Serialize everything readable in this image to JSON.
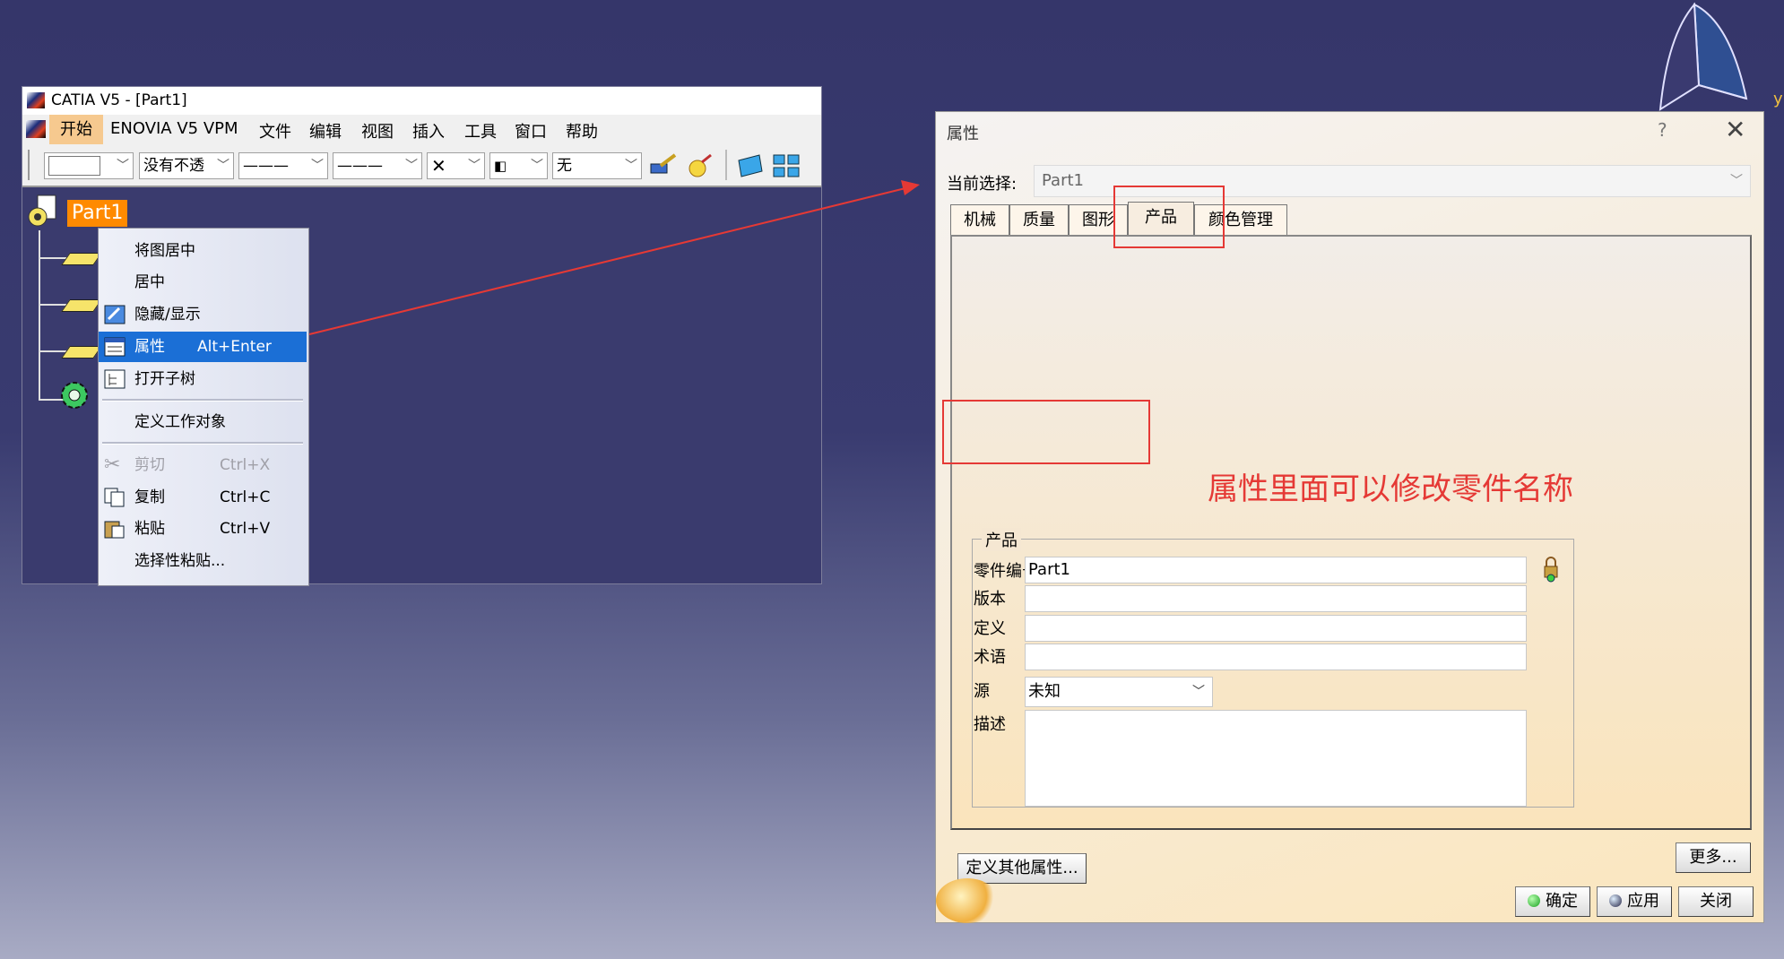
{
  "catia": {
    "title": "CATIA V5 - [Part1]",
    "menus": [
      "开始",
      "ENOVIA V5 VPM",
      "文件",
      "编辑",
      "视图",
      "插入",
      "工具",
      "窗口",
      "帮助"
    ],
    "toolbar": {
      "color_value": "",
      "transparency_value": "没有不透",
      "line_type_value": "———",
      "line_weight_value": "———",
      "layer_value": "无"
    },
    "tree": {
      "root_label": "Part1"
    },
    "context_menu": {
      "items": [
        {
          "label": "将图居中",
          "shortcut": ""
        },
        {
          "label": "居中",
          "shortcut": ""
        },
        {
          "label": "隐藏/显示",
          "shortcut": ""
        },
        {
          "label": "属性",
          "shortcut": "Alt+Enter"
        },
        {
          "label": "打开子树",
          "shortcut": ""
        },
        {
          "label": "定义工作对象",
          "shortcut": ""
        },
        {
          "label": "剪切",
          "shortcut": "Ctrl+X"
        },
        {
          "label": "复制",
          "shortcut": "Ctrl+C"
        },
        {
          "label": "粘贴",
          "shortcut": "Ctrl+V"
        },
        {
          "label": "选择性粘贴...",
          "shortcut": ""
        }
      ]
    }
  },
  "dialog": {
    "title": "属性",
    "help": "?",
    "close": "✕",
    "current_selection_label": "当前选择:",
    "current_selection_value": "Part1",
    "tabs": [
      "机械",
      "质量",
      "图形",
      "产品",
      "颜色管理"
    ],
    "active_tab": "产品",
    "annotation": "属性里面可以修改零件名称",
    "group_title": "产品",
    "fields": {
      "part_number_label": "零件编号",
      "part_number_value": "Part1",
      "revision_label": "版本",
      "revision_value": "",
      "definition_label": "定义",
      "definition_value": "",
      "nomenclature_label": "术语",
      "nomenclature_value": "",
      "source_label": "源",
      "source_value": "未知",
      "description_label": "描述",
      "description_value": ""
    },
    "buttons": {
      "define_other": "定义其他属性...",
      "more": "更多...",
      "ok": "确定",
      "apply": "应用",
      "close": "关闭"
    }
  },
  "compass": {
    "axis_label": "y"
  },
  "colors": {
    "annotation_red": "#e53935",
    "selection_blue": "#1b6fd6",
    "tree_highlight": "#ff8a00",
    "background": "#35366a"
  }
}
